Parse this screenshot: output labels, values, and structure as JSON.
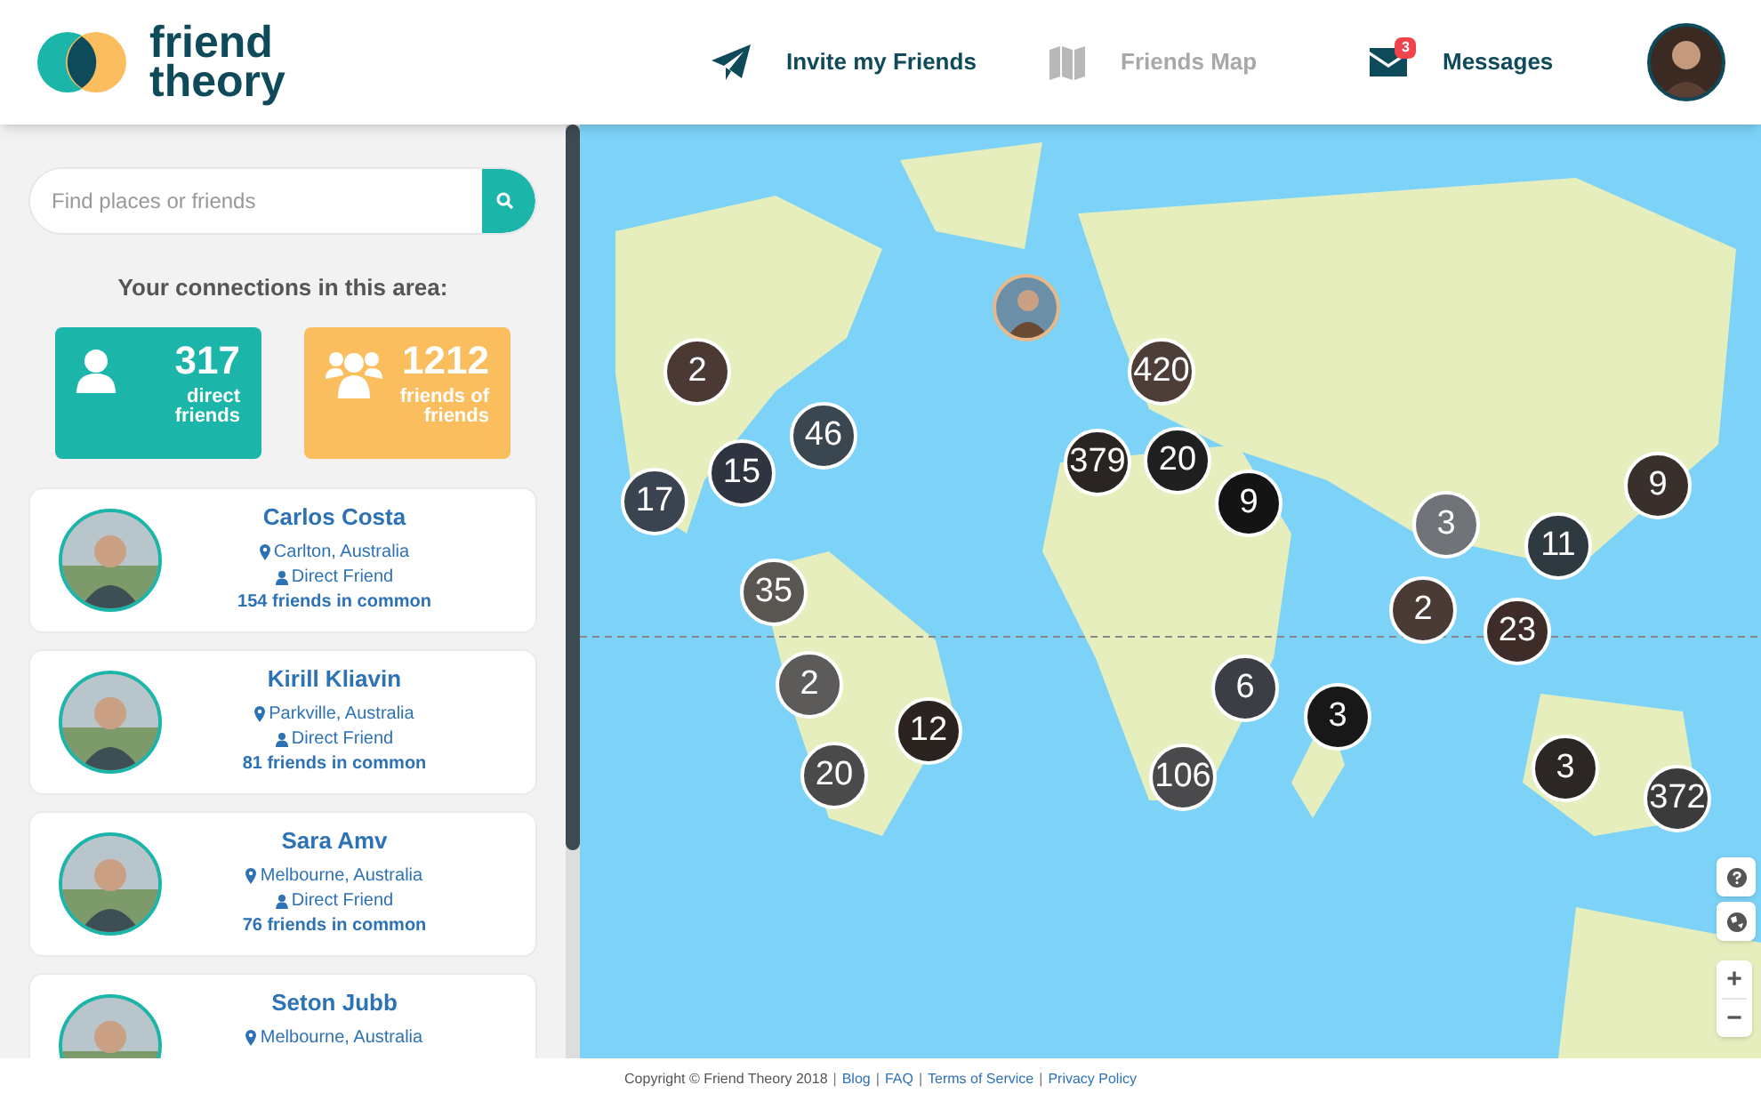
{
  "logo": {
    "line_1": "friend",
    "line_2": "theory"
  },
  "nav": [
    {
      "label": "Invite my Friends",
      "kind": "invite",
      "disabled": false
    },
    {
      "label": "Friends Map",
      "kind": "map",
      "disabled": true
    },
    {
      "label": "Messages",
      "kind": "messages",
      "disabled": false,
      "badge": "3"
    }
  ],
  "sidebar": {
    "search": {
      "placeholder": "Find places or friends"
    },
    "connections_title": "Your connections in this area:",
    "stats": [
      {
        "kind": "single",
        "count": "317",
        "label_1": "direct",
        "label_2": "friends",
        "color": "#1bb5a9"
      },
      {
        "kind": "group",
        "count": "1212",
        "label_1": "friends of",
        "label_2": "friends",
        "color": "#fbbe5f"
      }
    ],
    "friends": [
      {
        "name": "Carlos Costa",
        "location": "Carlton, Australia",
        "relation": "Direct Friend",
        "common": "154 friends in common"
      },
      {
        "name": "Kirill Kliavin",
        "location": "Parkville, Australia",
        "relation": "Direct Friend",
        "common": "81 friends in common"
      },
      {
        "name": "Sara Amv",
        "location": "Melbourne, Australia",
        "relation": "Direct Friend",
        "common": "76 friends in common"
      },
      {
        "name": "Seton Jubb",
        "location": "Melbourne, Australia"
      }
    ]
  },
  "map": {
    "clusters": [
      "2",
      "46",
      "15",
      "17",
      "35",
      "2",
      "12",
      "20",
      "420",
      "379",
      "20",
      "9",
      "3",
      "11",
      "9",
      "2",
      "23",
      "6",
      "3",
      "106",
      "3",
      "372"
    ],
    "zoom_in": "+",
    "zoom_out": "−"
  },
  "footer": [
    {
      "kind": "text",
      "text": "Copyright © Friend Theory 2018"
    },
    {
      "kind": "sep",
      "text": "|"
    },
    {
      "kind": "link",
      "text": "Blog"
    },
    {
      "kind": "sep",
      "text": "|"
    },
    {
      "kind": "link",
      "text": "FAQ"
    },
    {
      "kind": "sep",
      "text": "|"
    },
    {
      "kind": "link",
      "text": "Terms of Service"
    },
    {
      "kind": "sep",
      "text": "|"
    },
    {
      "kind": "link",
      "text": "Privacy Policy"
    }
  ]
}
